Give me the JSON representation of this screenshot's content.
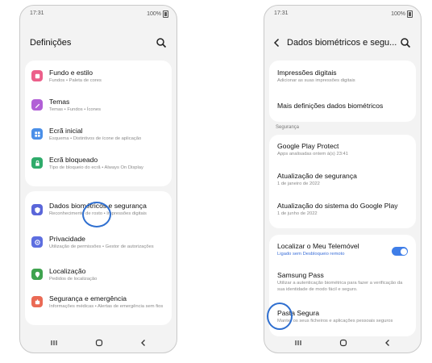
{
  "left_screen": {
    "status": {
      "time": "17:31",
      "battery": "100%"
    },
    "header": {
      "title": "Definições"
    },
    "items": [
      {
        "label": "Fundo e estilo",
        "sub": "Fundos  •  Paleta de cores",
        "icon": "palette-icon",
        "color": "#ec5f8a"
      },
      {
        "label": "Temas",
        "sub": "Temas  •  Fundos  •  Ícones",
        "icon": "brush-icon",
        "color": "#b15fd6"
      },
      {
        "label": "Ecrã inicial",
        "sub": "Esquema  •  Distintivos de ícone de aplicação",
        "icon": "grid-icon",
        "color": "#4a8fe8"
      },
      {
        "label": "Ecrã bloqueado",
        "sub": "Tipo de bloqueio do ecrã  •  Always On Display",
        "icon": "lock-icon",
        "color": "#2fab6b"
      },
      {
        "label": "Dados biométricos e segurança",
        "sub": "Reconhecimento de rosto  •  Impressões digitais",
        "icon": "shield-icon",
        "color": "#5a66d9"
      },
      {
        "label": "Privacidade",
        "sub": "Utilização de permissões  •  Gestor de autorizações",
        "icon": "privacy-icon",
        "color": "#5d6ee0"
      },
      {
        "label": "Localização",
        "sub": "Pedidos de localização",
        "icon": "location-icon",
        "color": "#3fa34f"
      },
      {
        "label": "Segurança e emergência",
        "sub": "Informações médicas  •  Alertas de emergência sem fios",
        "icon": "emergency-icon",
        "color": "#ea6a55"
      }
    ]
  },
  "right_screen": {
    "status": {
      "time": "17:31",
      "battery": "100%"
    },
    "header": {
      "title": "Dados biométricos e segu..."
    },
    "group1": [
      {
        "label": "Impressões digitais",
        "sub": "Adicionar as suas impressões digitais"
      },
      {
        "label": "Mais definições dados biométricos"
      }
    ],
    "section_label": "Segurança",
    "group2": [
      {
        "label": "Google Play Protect",
        "sub": "Apps analisadas ontem à(s) 23:41"
      },
      {
        "label": "Atualização de segurança",
        "sub": "1 de janeiro de 2022"
      },
      {
        "label": "Atualização do sistema do Google Play",
        "sub": "1 de junho de 2022"
      }
    ],
    "group3": [
      {
        "label": "Localizar o Meu Telemóvel",
        "sub": "Ligado sem Desbloqueio remoto",
        "toggle": "on"
      },
      {
        "label": "Samsung Pass",
        "sub": "Utilizar a autenticação biométrica para fazer a verificação da sua identidade de modo fácil e seguro."
      },
      {
        "label": "Pasta Segura",
        "sub": "Manter os seus ficheiros e aplicações pessoais seguros"
      }
    ]
  },
  "colors": {
    "highlight_circle": "#2f6fd0",
    "toggle_on": "#3f7ee8"
  }
}
